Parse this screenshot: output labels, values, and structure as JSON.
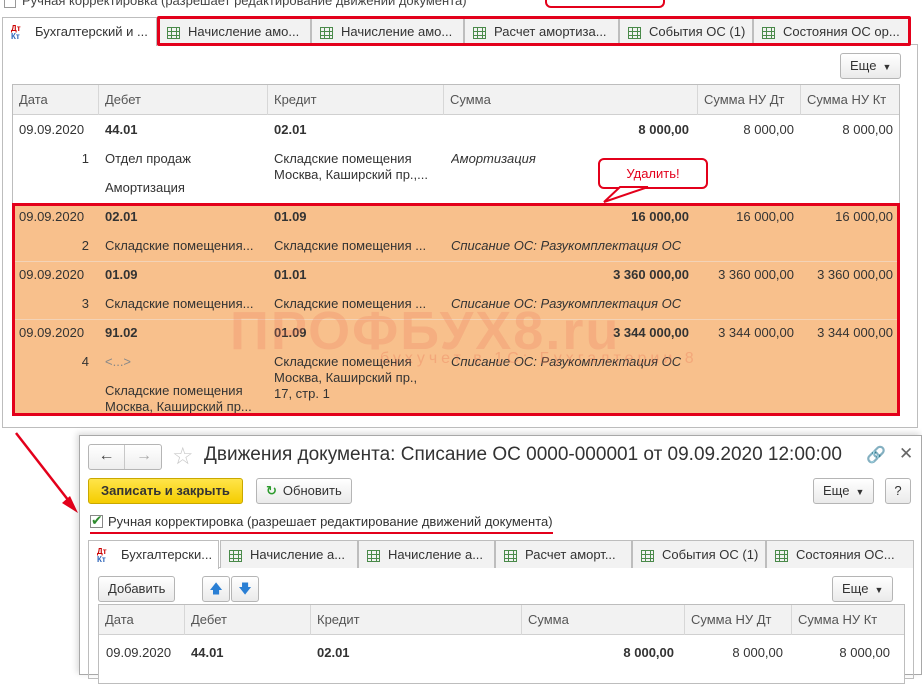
{
  "top_window": {
    "manual_correction_label": "Ручная корректировка (разрешает редактирование движений документа)",
    "tabs": [
      {
        "label": "Бухгалтерский и ...",
        "icon": "dt-kt-icon"
      },
      {
        "label": "Начисление амо...",
        "icon": "grid-icon"
      },
      {
        "label": "Начисление амо...",
        "icon": "grid-icon"
      },
      {
        "label": "Расчет амортиза...",
        "icon": "grid-icon"
      },
      {
        "label": "События ОС (1)",
        "icon": "grid-icon"
      },
      {
        "label": "Состояния ОС ор...",
        "icon": "grid-icon"
      }
    ],
    "more_button": "Еще",
    "columns": [
      "Дата",
      "Дебет",
      "Кредит",
      "Сумма",
      "Сумма НУ Дт",
      "Сумма НУ Кт"
    ],
    "rows": [
      {
        "date": "09.09.2020",
        "num": "1",
        "debit": "44.01",
        "debit_sub1": "Отдел продаж",
        "debit_sub2": "Амортизация",
        "credit": "02.01",
        "credit_sub1": "Складские помещения",
        "credit_sub2": "Москва, Каширский пр.,...",
        "amount": "8 000,00",
        "amount_note": "Амортизация",
        "nu_dt": "8 000,00",
        "nu_kt": "8 000,00"
      },
      {
        "date": "09.09.2020",
        "num": "2",
        "debit": "02.01",
        "debit_sub1": "Складские помещения...",
        "credit": "01.09",
        "credit_sub1": "Складские помещения ...",
        "amount": "16 000,00",
        "amount_note": "Списание ОС: Разукомплектация ОС",
        "nu_dt": "16 000,00",
        "nu_kt": "16 000,00"
      },
      {
        "date": "09.09.2020",
        "num": "3",
        "debit": "01.09",
        "debit_sub1": "Складские помещения...",
        "credit": "01.01",
        "credit_sub1": "Складские помещения ...",
        "amount": "3 360 000,00",
        "amount_note": "Списание ОС: Разукомплектация ОС",
        "nu_dt": "3 360 000,00",
        "nu_kt": "3 360 000,00"
      },
      {
        "date": "09.09.2020",
        "num": "4",
        "debit": "91.02",
        "debit_sub1": "<...>",
        "debit_sub2": "Складские помещения",
        "debit_sub3": "Москва, Каширский пр...",
        "credit": "01.09",
        "credit_sub1": "Складские помещения",
        "credit_sub2": "Москва, Каширский пр.,",
        "credit_sub3": "17, стр. 1",
        "amount": "3 344 000,00",
        "amount_note": "Списание ОС: Разукомплектация ОС",
        "nu_dt": "3 344 000,00",
        "nu_kt": "3 344 000,00"
      }
    ],
    "callout_delete": "Удалить!",
    "watermark": "ПРОФБУХ8.ru",
    "watermark_sub": "бухучет в 1С: Бухгалтерии 8"
  },
  "bottom_window": {
    "title": "Движения документа: Списание ОС 0000-000001 от 09.09.2020 12:00:00",
    "nav_back": "←",
    "nav_forward": "→",
    "save_close_button": "Записать и закрыть",
    "refresh_button": "Обновить",
    "more_button": "Еще",
    "help_button": "?",
    "manual_correction_label": "Ручная корректировка (разрешает редактирование движений документа)",
    "tabs": [
      {
        "label": "Бухгалтерски...",
        "icon": "dt-kt-icon"
      },
      {
        "label": "Начисление а...",
        "icon": "grid-icon"
      },
      {
        "label": "Начисление а...",
        "icon": "grid-icon"
      },
      {
        "label": "Расчет аморт...",
        "icon": "grid-icon"
      },
      {
        "label": "События ОС (1)",
        "icon": "grid-icon"
      },
      {
        "label": "Состояния ОС...",
        "icon": "grid-icon"
      }
    ],
    "add_button": "Добавить",
    "table_more_button": "Еще",
    "columns": [
      "Дата",
      "Дебет",
      "Кредит",
      "Сумма",
      "Сумма НУ Дт",
      "Сумма НУ Кт"
    ],
    "rows": [
      {
        "date": "09.09.2020",
        "debit": "44.01",
        "credit": "02.01",
        "amount": "8 000,00",
        "nu_dt": "8 000,00",
        "nu_kt": "8 000,00"
      }
    ]
  },
  "colors": {
    "highlight_red": "#e3001b",
    "row_highlight": "#f8c08c",
    "save_button": "#f5cd00"
  }
}
